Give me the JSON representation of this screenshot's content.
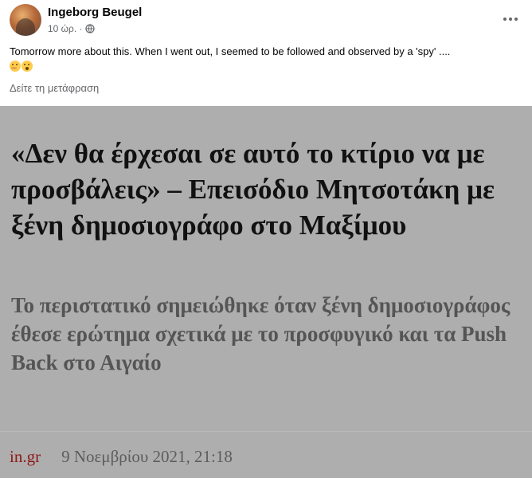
{
  "post": {
    "author": "Ingeborg Beugel",
    "time": "10 ώρ. ·",
    "privacy_icon": "globe-icon",
    "more_icon": "more-options-icon",
    "text": "Tomorrow more about this. When I went out, I seemed to be followed and observed by a 'spy' ....",
    "emojis": [
      "thinking-face-emoji",
      "astonished-face-emoji"
    ],
    "translate_label": "Δείτε τη μετάφραση"
  },
  "article": {
    "headline": "«Δεν θα έρχεσαι σε αυτό το κτίριο να με προσβάλεις» – Επεισόδιο Μητσοτάκη με ξένη δημοσιογράφο στο Μαξίμου",
    "subheadline": "Το περιστατικό σημειώθηκε όταν ξένη δημοσιογράφος έθεσε ερώτημα σχετικά με το προσφυγικό και τα Push Back στο Αιγαίο",
    "source": "in.gr",
    "date": "9 Νοεμβρίου 2021, 21:18",
    "colors": {
      "background": "#aeaeae",
      "headline": "#111111",
      "subheadline": "#555555",
      "source": "#8e1818"
    }
  }
}
